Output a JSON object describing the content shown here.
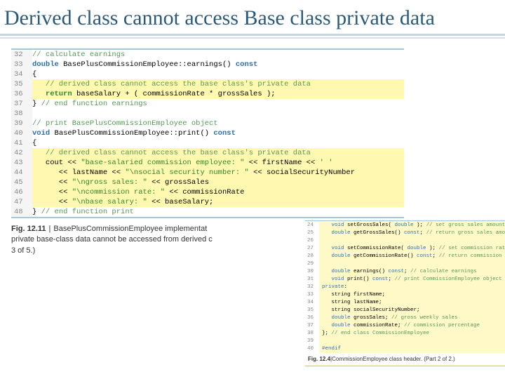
{
  "title": "Derived class cannot access Base class private data",
  "main_code": {
    "lines": [
      {
        "n": "32",
        "segs": [
          [
            "cmt",
            "// calculate earnings"
          ]
        ]
      },
      {
        "n": "33",
        "segs": [
          [
            "kw-blue",
            "double"
          ],
          [
            "",
            " BasePlusCommissionEmployee::earnings() "
          ],
          [
            "kw-blue",
            "const"
          ]
        ]
      },
      {
        "n": "34",
        "segs": [
          [
            "",
            "{"
          ]
        ]
      },
      {
        "n": "35",
        "hl": true,
        "indent": 3,
        "segs": [
          [
            "cmt",
            "// derived class cannot access the base class's private data"
          ]
        ]
      },
      {
        "n": "36",
        "hl": true,
        "indent": 3,
        "segs": [
          [
            "kw-green",
            "return"
          ],
          [
            "",
            " baseSalary + ( commissionRate * grossSales );"
          ]
        ]
      },
      {
        "n": "37",
        "segs": [
          [
            "",
            "} "
          ],
          [
            "cmt",
            "// end function earnings"
          ]
        ]
      },
      {
        "n": "38",
        "segs": [
          [
            "",
            ""
          ]
        ]
      },
      {
        "n": "39",
        "segs": [
          [
            "cmt",
            "// print BasePlusCommissionEmployee object"
          ]
        ]
      },
      {
        "n": "40",
        "segs": [
          [
            "kw-blue",
            "void"
          ],
          [
            "",
            " BasePlusCommissionEmployee::print() "
          ],
          [
            "kw-blue",
            "const"
          ]
        ]
      },
      {
        "n": "41",
        "segs": [
          [
            "",
            "{"
          ]
        ]
      },
      {
        "n": "42",
        "hl": true,
        "indent": 3,
        "segs": [
          [
            "cmt",
            "// derived class cannot access the base class's private data"
          ]
        ]
      },
      {
        "n": "43",
        "hl": true,
        "indent": 3,
        "segs": [
          [
            "",
            "cout << "
          ],
          [
            "str",
            "\"base-salaried commission employee: \""
          ],
          [
            "",
            " << firstName << "
          ],
          [
            "str",
            "' '"
          ]
        ]
      },
      {
        "n": "44",
        "hl": true,
        "indent": 3,
        "segs": [
          [
            "",
            "   << lastName << "
          ],
          [
            "str",
            "\"\\nsocial security number: \""
          ],
          [
            "",
            " << socialSecurityNumber"
          ]
        ]
      },
      {
        "n": "45",
        "hl": true,
        "indent": 3,
        "segs": [
          [
            "",
            "   << "
          ],
          [
            "str",
            "\"\\ngross sales: \""
          ],
          [
            "",
            " << grossSales"
          ]
        ]
      },
      {
        "n": "46",
        "hl": true,
        "indent": 3,
        "segs": [
          [
            "",
            "   << "
          ],
          [
            "str",
            "\"\\ncommission rate: \""
          ],
          [
            "",
            " << commissionRate"
          ]
        ]
      },
      {
        "n": "47",
        "hl": true,
        "indent": 3,
        "segs": [
          [
            "",
            "   << "
          ],
          [
            "str",
            "\"\\nbase salary: \""
          ],
          [
            "",
            " << baseSalary;"
          ]
        ]
      },
      {
        "n": "48",
        "segs": [
          [
            "",
            "} "
          ],
          [
            "cmt",
            "// end function print"
          ]
        ]
      }
    ]
  },
  "main_caption": {
    "fig_label": "Fig. 12.11",
    "text_a": "BasePlusCommissionEmployee implementat",
    "text_b": "private base-class data cannot be accessed from derived c",
    "text_c": "3 of 5.)"
  },
  "inset_code": {
    "lines": [
      {
        "n": "24",
        "segs": [
          [
            "kw-mini",
            "   void"
          ],
          [
            "",
            " setGrossSales( "
          ],
          [
            "kw-mini",
            "double"
          ],
          [
            "",
            " ); "
          ],
          [
            "cmt-mini",
            "// set gross sales amount"
          ]
        ]
      },
      {
        "n": "25",
        "segs": [
          [
            "kw-mini",
            "   double"
          ],
          [
            "",
            " getGrossSales() "
          ],
          [
            "kw-mini",
            "const"
          ],
          [
            "",
            "; "
          ],
          [
            "cmt-mini",
            "// return gross sales amount"
          ]
        ]
      },
      {
        "n": "26",
        "segs": [
          [
            "",
            ""
          ]
        ]
      },
      {
        "n": "27",
        "segs": [
          [
            "kw-mini",
            "   void"
          ],
          [
            "",
            " setCommissionRate( "
          ],
          [
            "kw-mini",
            "double"
          ],
          [
            "",
            " ); "
          ],
          [
            "cmt-mini",
            "// set commission rate (percentag"
          ]
        ]
      },
      {
        "n": "28",
        "segs": [
          [
            "kw-mini",
            "   double"
          ],
          [
            "",
            " getCommissionRate() "
          ],
          [
            "kw-mini",
            "const"
          ],
          [
            "",
            "; "
          ],
          [
            "cmt-mini",
            "// return commission rate"
          ]
        ]
      },
      {
        "n": "29",
        "segs": [
          [
            "",
            ""
          ]
        ]
      },
      {
        "n": "30",
        "segs": [
          [
            "kw-mini",
            "   double"
          ],
          [
            "",
            " earnings() "
          ],
          [
            "kw-mini",
            "const"
          ],
          [
            "",
            "; "
          ],
          [
            "cmt-mini",
            "// calculate earnings"
          ]
        ]
      },
      {
        "n": "31",
        "segs": [
          [
            "kw-mini",
            "   void"
          ],
          [
            "",
            " print() "
          ],
          [
            "kw-mini",
            "const"
          ],
          [
            "",
            "; "
          ],
          [
            "cmt-mini",
            "// print CommissionEmployee object"
          ]
        ]
      },
      {
        "n": "32",
        "segs": [
          [
            "kw-mini",
            "private"
          ],
          [
            "",
            ":"
          ]
        ]
      },
      {
        "n": "33",
        "segs": [
          [
            "",
            "   string firstName;"
          ]
        ]
      },
      {
        "n": "34",
        "segs": [
          [
            "",
            "   string lastName;"
          ]
        ]
      },
      {
        "n": "35",
        "segs": [
          [
            "",
            "   string socialSecurityNumber;"
          ]
        ]
      },
      {
        "n": "36",
        "segs": [
          [
            "kw-mini",
            "   double"
          ],
          [
            "",
            " grossSales; "
          ],
          [
            "cmt-mini",
            "// gross weekly sales"
          ]
        ]
      },
      {
        "n": "37",
        "segs": [
          [
            "kw-mini",
            "   double"
          ],
          [
            "",
            " commissionRate; "
          ],
          [
            "cmt-mini",
            "// commission percentage"
          ]
        ]
      },
      {
        "n": "38",
        "segs": [
          [
            "",
            "}; "
          ],
          [
            "cmt-mini",
            "// end class CommissionEmployee"
          ]
        ]
      },
      {
        "n": "39",
        "segs": [
          [
            "",
            ""
          ]
        ]
      },
      {
        "n": "40",
        "segs": [
          [
            "kw-mini",
            "#endif"
          ]
        ]
      }
    ]
  },
  "inset_caption": {
    "fig_label": "Fig. 12.4",
    "text": "CommissionEmployee class header. (Part 2 of 2.)"
  }
}
